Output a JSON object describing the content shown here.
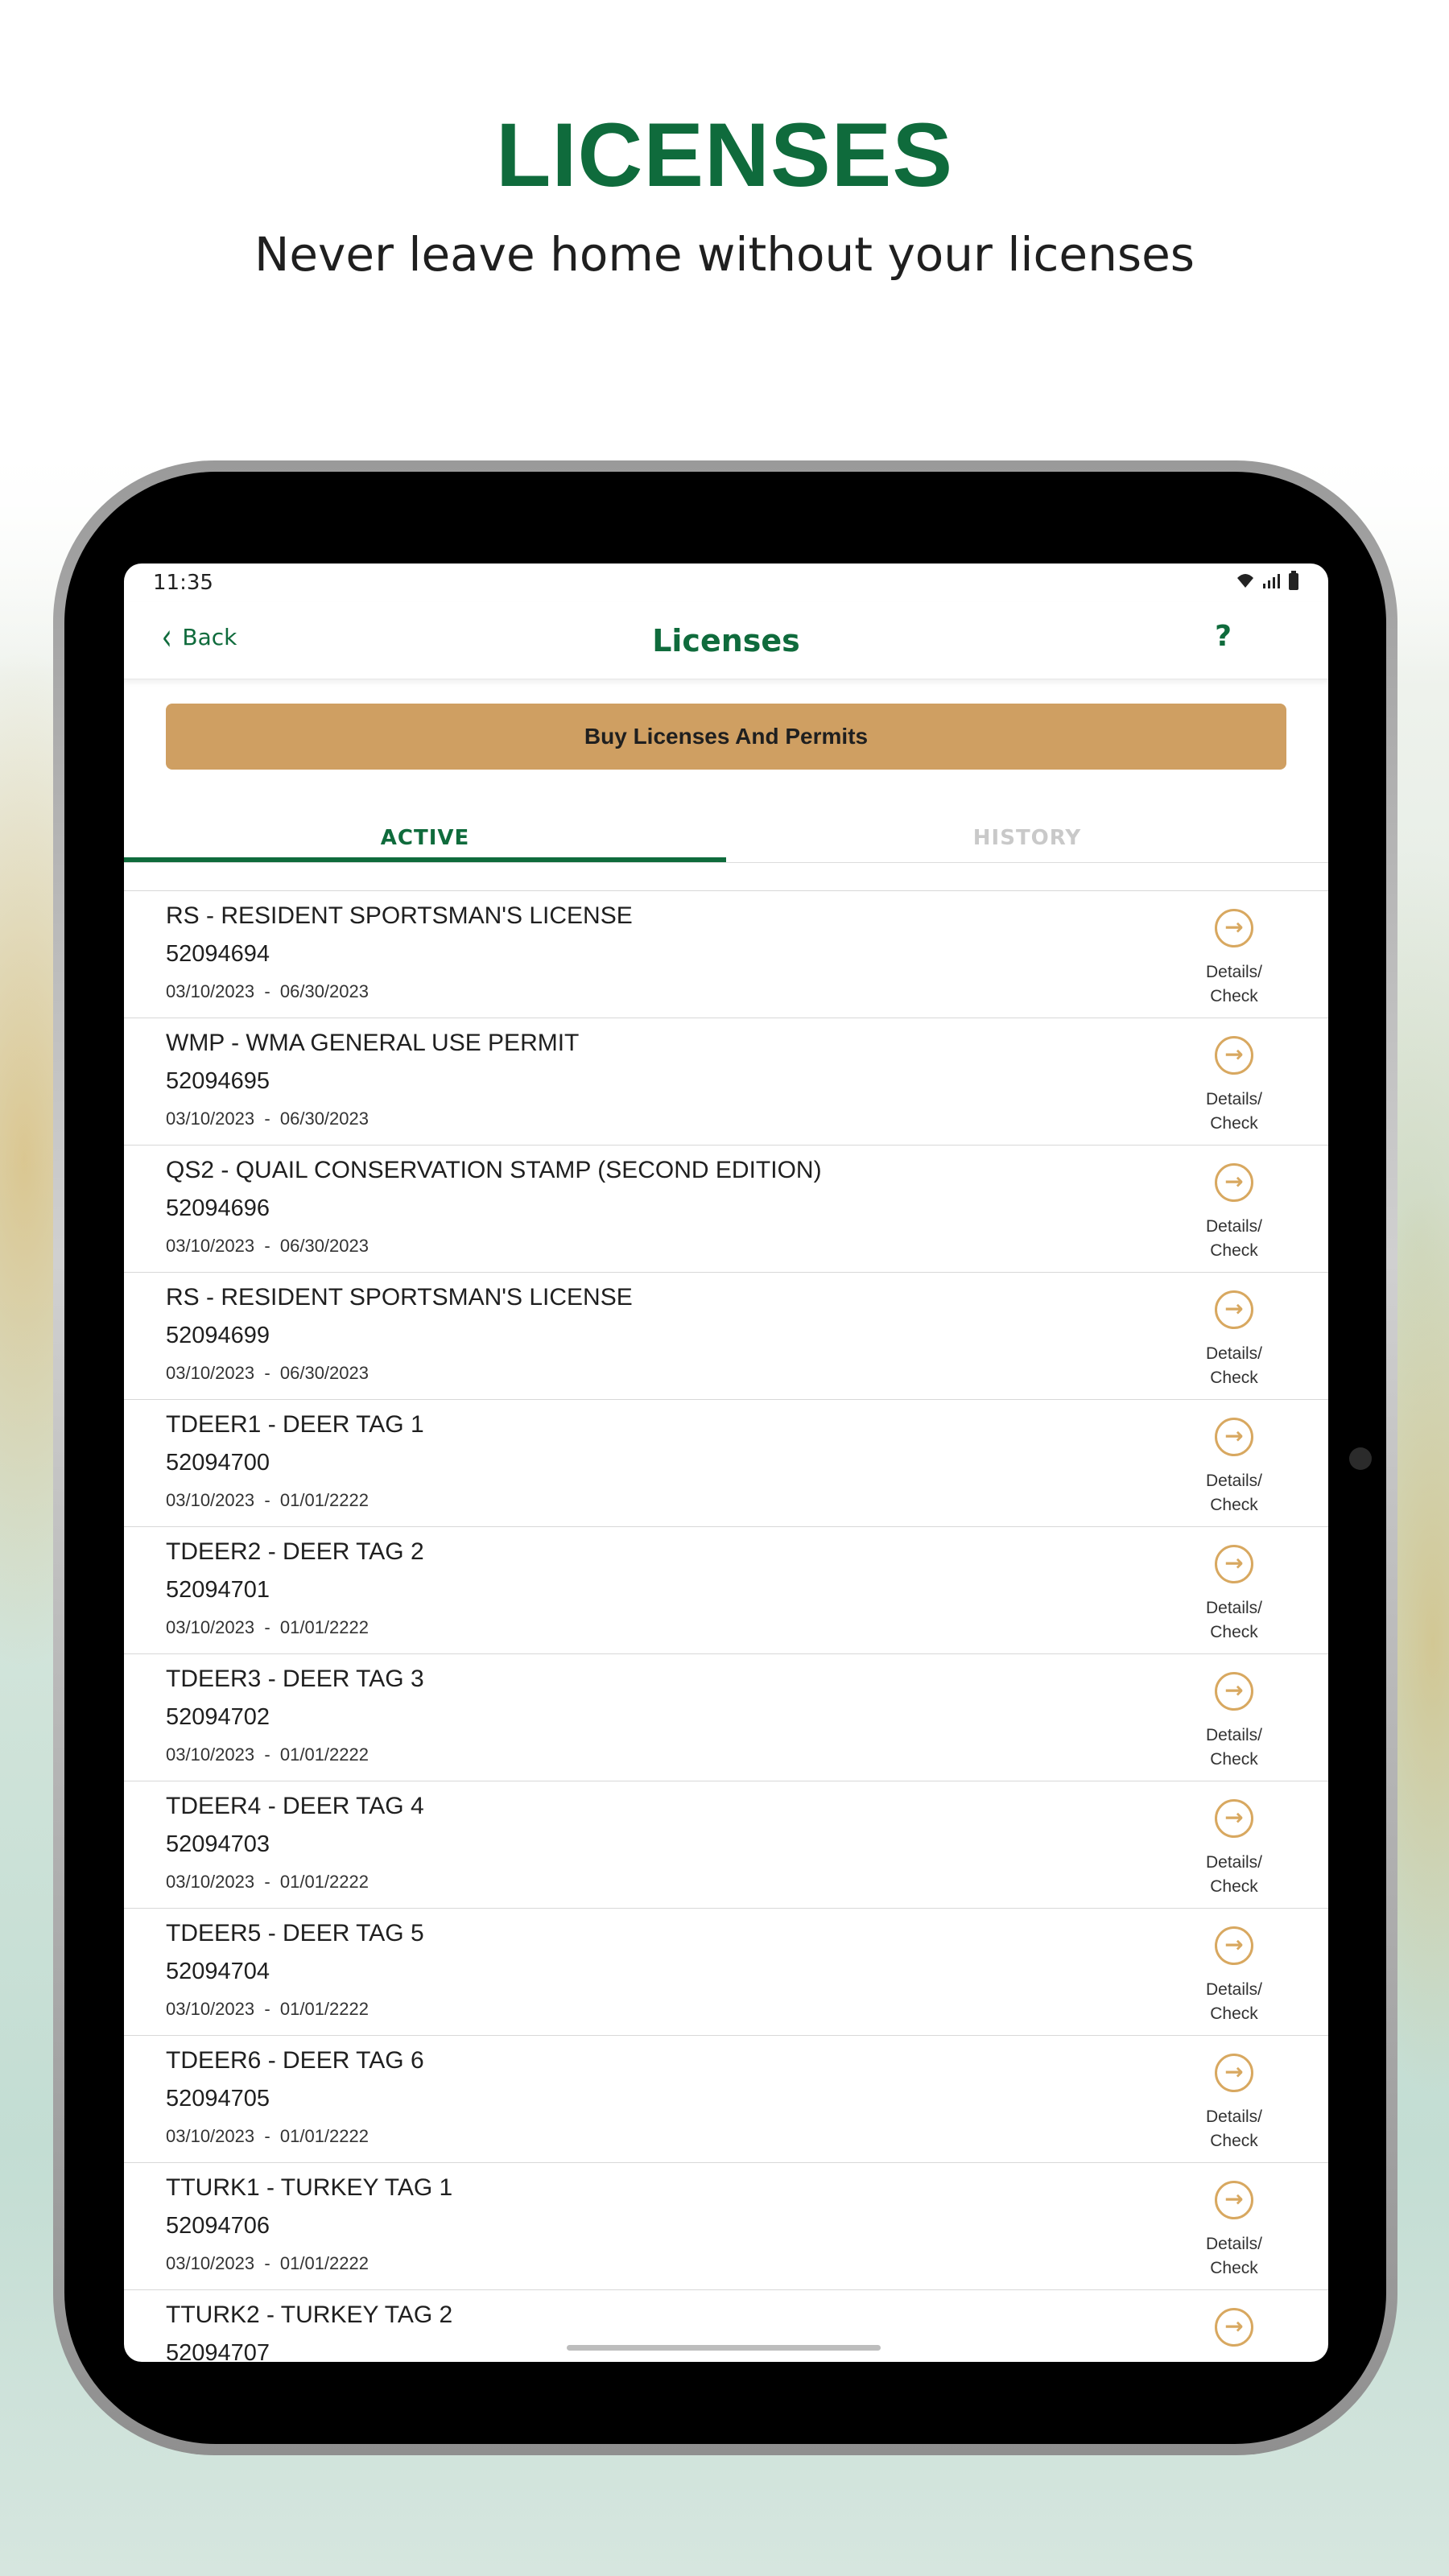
{
  "promo": {
    "headline": "LICENSES",
    "subheadline": "Never leave home without your licenses"
  },
  "status_bar": {
    "time": "11:35",
    "icons": [
      "wifi-icon",
      "signal-icon",
      "battery-icon"
    ]
  },
  "header": {
    "back_label": "Back",
    "title": "Licenses",
    "help_label": "?"
  },
  "buy_button_label": "Buy Licenses And Permits",
  "tabs": [
    {
      "label": "ACTIVE",
      "active": true
    },
    {
      "label": "HISTORY",
      "active": false
    }
  ],
  "action": {
    "line1": "Details/",
    "line2": "Check"
  },
  "licenses": [
    {
      "title": "RS - RESIDENT SPORTSMAN'S LICENSE",
      "number": "52094694",
      "dates": "03/10/2023  -  06/30/2023"
    },
    {
      "title": "WMP - WMA GENERAL USE PERMIT",
      "number": "52094695",
      "dates": "03/10/2023  -  06/30/2023"
    },
    {
      "title": "QS2 - QUAIL CONSERVATION STAMP (SECOND EDITION)",
      "number": "52094696",
      "dates": "03/10/2023  -  06/30/2023"
    },
    {
      "title": "RS - RESIDENT SPORTSMAN'S LICENSE",
      "number": "52094699",
      "dates": "03/10/2023  -  06/30/2023"
    },
    {
      "title": "TDEER1 - DEER TAG 1",
      "number": "52094700",
      "dates": "03/10/2023  -  01/01/2222"
    },
    {
      "title": "TDEER2 - DEER TAG 2",
      "number": "52094701",
      "dates": "03/10/2023  -  01/01/2222"
    },
    {
      "title": "TDEER3 - DEER TAG 3",
      "number": "52094702",
      "dates": "03/10/2023  -  01/01/2222"
    },
    {
      "title": "TDEER4 - DEER TAG 4",
      "number": "52094703",
      "dates": "03/10/2023  -  01/01/2222"
    },
    {
      "title": "TDEER5 - DEER TAG 5",
      "number": "52094704",
      "dates": "03/10/2023  -  01/01/2222"
    },
    {
      "title": "TDEER6 - DEER TAG 6",
      "number": "52094705",
      "dates": "03/10/2023  -  01/01/2222"
    },
    {
      "title": "TTURK1 - TURKEY TAG 1",
      "number": "52094706",
      "dates": "03/10/2023  -  01/01/2222"
    },
    {
      "title": "TTURK2 - TURKEY TAG 2",
      "number": "52094707",
      "dates": ""
    }
  ],
  "colors": {
    "brand_green": "#0f6b3c",
    "accent_gold": "#cf9f62",
    "icon_gold": "#d8a860"
  }
}
